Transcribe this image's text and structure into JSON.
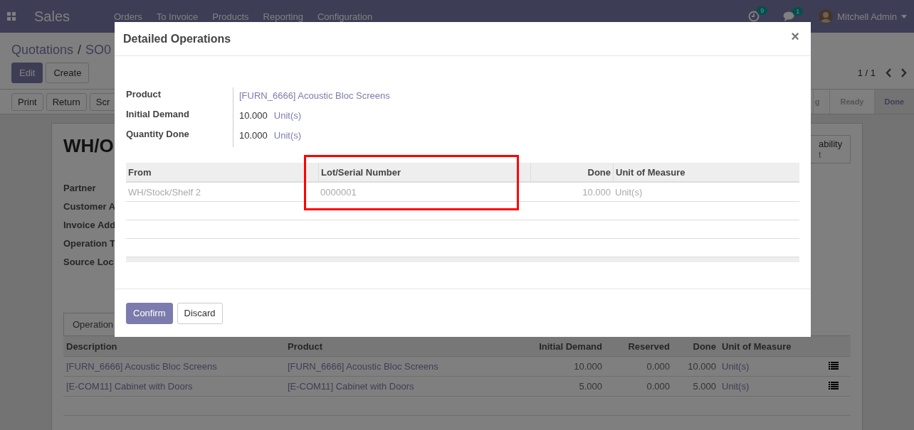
{
  "navbar": {
    "app": "Sales",
    "menu": [
      "Orders",
      "To Invoice",
      "Products",
      "Reporting",
      "Configuration"
    ],
    "activity_count": "9",
    "message_count": "1",
    "user": "Mitchell Admin"
  },
  "breadcrumb": {
    "parent": "Quotations",
    "separator": "/",
    "current": "SO0"
  },
  "actions": [
    "Edit",
    "Create"
  ],
  "pager": "1 / 1",
  "header_buttons": [
    "Print",
    "Return",
    "Scr"
  ],
  "stages": [
    {
      "label": "g",
      "selected": false
    },
    {
      "label": "Ready",
      "selected": false
    },
    {
      "label": "Done",
      "selected": true
    }
  ],
  "record": {
    "title": "WH/O",
    "fields": [
      "Partner",
      "Customer A",
      "Invoice Add",
      "Operation T",
      "Source Loc"
    ],
    "smart_button": {
      "line_1": "ability",
      "line_2": "t"
    }
  },
  "notebook": {
    "tab": "Operation",
    "columns": [
      "Description",
      "Product",
      "Initial Demand",
      "Reserved",
      "Done",
      "Unit of Measure"
    ],
    "rows": [
      [
        "[FURN_6666] Acoustic Bloc Screens",
        "[FURN_6666] Acoustic Bloc Screens",
        "10.000",
        "0.000",
        "10.000",
        "Unit(s)"
      ],
      [
        "[E-COM11] Cabinet with Doors",
        "[E-COM11] Cabinet with Doors",
        "5.000",
        "0.000",
        "5.000",
        "Unit(s)"
      ]
    ]
  },
  "dialog": {
    "title": "Detailed Operations",
    "close": "×",
    "fields": [
      {
        "label": "Product",
        "kind": "link",
        "value": "[FURN_6666] Acoustic Bloc Screens"
      },
      {
        "label": "Initial Demand",
        "kind": "quantity",
        "value": "10.000",
        "unit": "Unit(s)"
      },
      {
        "label": "Quantity Done",
        "kind": "quantity",
        "value": "10.000",
        "unit": "Unit(s)"
      }
    ],
    "columns": [
      "From",
      "Lot/Serial Number",
      "Done",
      "Unit of Measure"
    ],
    "rows": [
      [
        "WH/Stock/Shelf 2",
        "0000001",
        "10.000",
        "Unit(s)"
      ]
    ],
    "buttons": [
      {
        "label": "Confirm",
        "kind": "primary"
      },
      {
        "label": "Discard",
        "kind": "secondary"
      }
    ]
  }
}
